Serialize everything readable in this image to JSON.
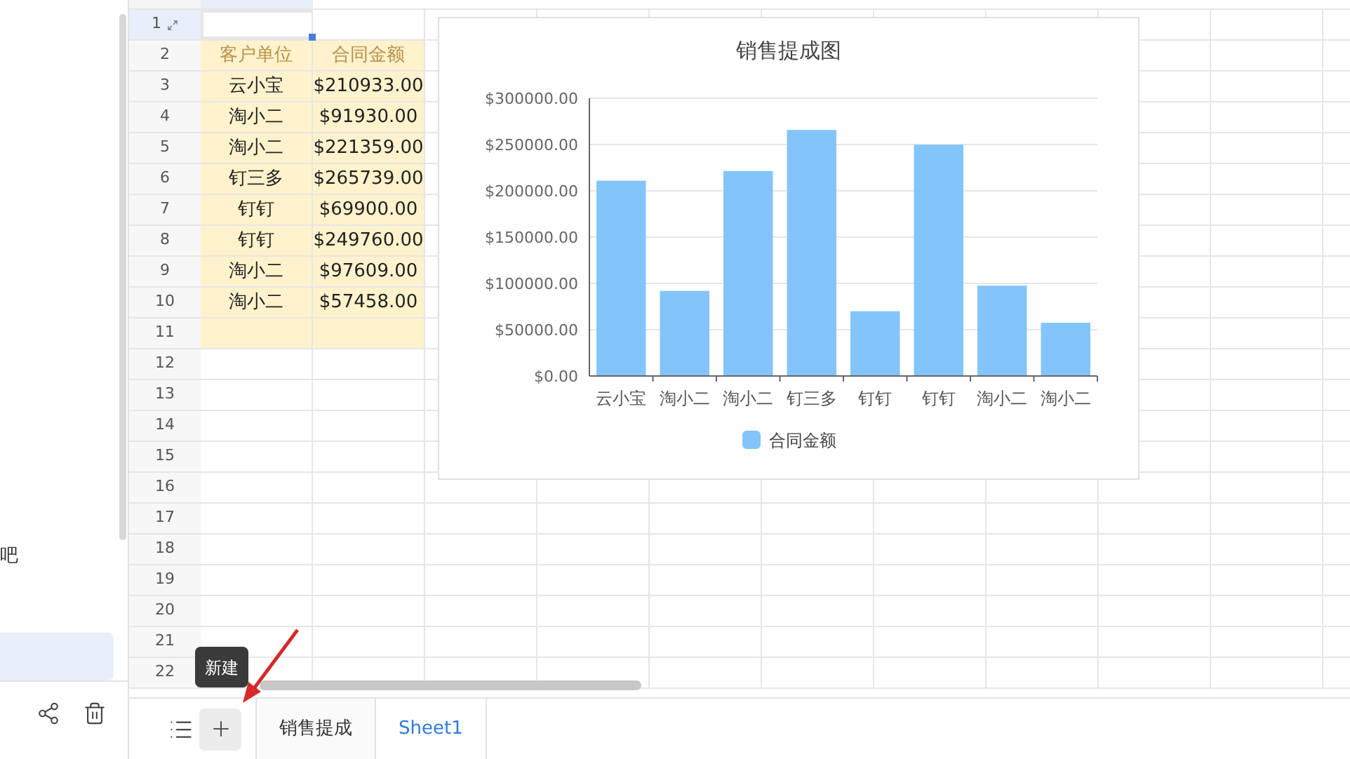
{
  "sidebar": {
    "text_fragment": "吧"
  },
  "sheet": {
    "row_numbers": [
      "1",
      "2",
      "3",
      "4",
      "5",
      "6",
      "7",
      "8",
      "9",
      "10",
      "11",
      "12",
      "13",
      "14",
      "15",
      "16",
      "17",
      "18",
      "19",
      "20",
      "21",
      "22"
    ],
    "table": {
      "columns": [
        "客户单位",
        "合同金额"
      ],
      "rows": [
        [
          "云小宝",
          "$210933.00"
        ],
        [
          "淘小二",
          "$91930.00"
        ],
        [
          "淘小二",
          "$221359.00"
        ],
        [
          "钉三多",
          "$265739.00"
        ],
        [
          "钉钉",
          "$69900.00"
        ],
        [
          "钉钉",
          "$249760.00"
        ],
        [
          "淘小二",
          "$97609.00"
        ],
        [
          "淘小二",
          "$57458.00"
        ]
      ]
    },
    "chart": {
      "chart_data": {
        "type": "bar",
        "title": "销售提成图",
        "categories": [
          "云小宝",
          "淘小二",
          "淘小二",
          "钉三多",
          "钉钉",
          "钉钉",
          "淘小二",
          "淘小二"
        ],
        "series": [
          {
            "name": "合同金额",
            "color": "#83c5fb",
            "values": [
              210933,
              91930,
              221359,
              265739,
              69900,
              249760,
              97609,
              57458
            ]
          }
        ],
        "ylim": [
          0,
          300000
        ],
        "grid": true,
        "yticks": [
          {
            "value": 0,
            "label": "$0.00"
          },
          {
            "value": 50000,
            "label": "$50000.00"
          },
          {
            "value": 100000,
            "label": "$100000.00"
          },
          {
            "value": 150000,
            "label": "$150000.00"
          },
          {
            "value": 200000,
            "label": "$200000.00"
          },
          {
            "value": 250000,
            "label": "$250000.00"
          },
          {
            "value": 300000,
            "label": "$300000.00"
          }
        ]
      }
    }
  },
  "tooltip": "新建",
  "sheet_tabs": [
    {
      "label": "销售提成",
      "selected": false
    },
    {
      "label": "Sheet1",
      "selected": true
    }
  ]
}
